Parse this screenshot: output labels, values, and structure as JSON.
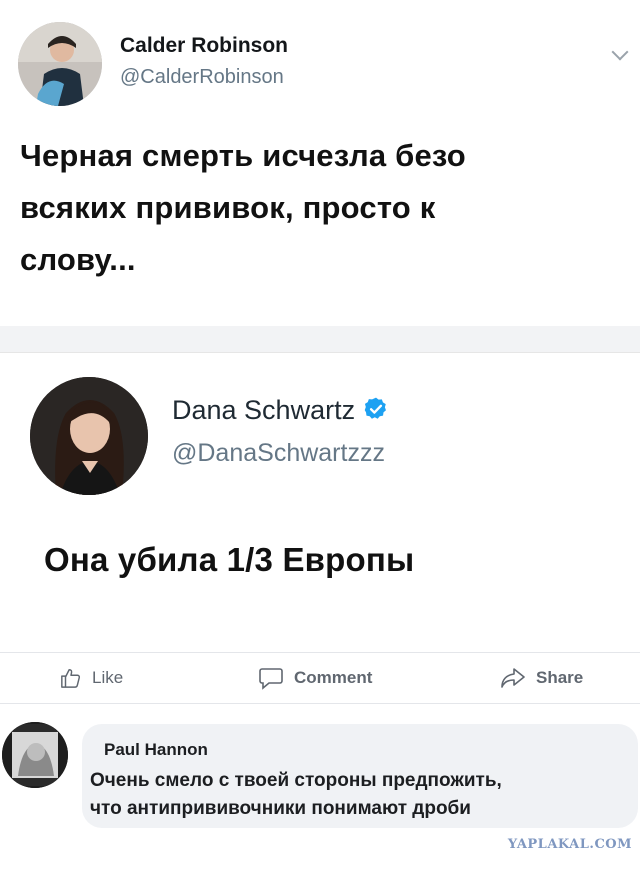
{
  "tweet1": {
    "author_name": "Calder Robinson",
    "author_handle": "@CalderRobinson",
    "text_lines": [
      "Черная смерть исчезла безо",
      "всяких прививок, просто к",
      "слову..."
    ]
  },
  "tweet2": {
    "author_name": "Dana Schwartz",
    "author_handle": "@DanaSchwartzzz",
    "text": "Она убила 1/3 Европы"
  },
  "actions": {
    "like_label": "Like",
    "comment_label": "Comment",
    "share_label": "Share"
  },
  "comment": {
    "author": "Paul Hannon",
    "lines": [
      "Очень смело с твоей стороны предпожить,",
      "что антипрививочники понимают дроби"
    ]
  },
  "watermark": "YAPLAKAL.COM",
  "colors": {
    "verified_blue": "#1da1f2",
    "handle_gray": "#657786",
    "bubble_bg": "#f0f2f5",
    "action_gray": "#606770",
    "watermark_blue": "#7f97c0"
  },
  "icons": [
    "chevron-down-icon",
    "verified-badge-icon",
    "like-icon",
    "comment-icon",
    "share-icon"
  ]
}
